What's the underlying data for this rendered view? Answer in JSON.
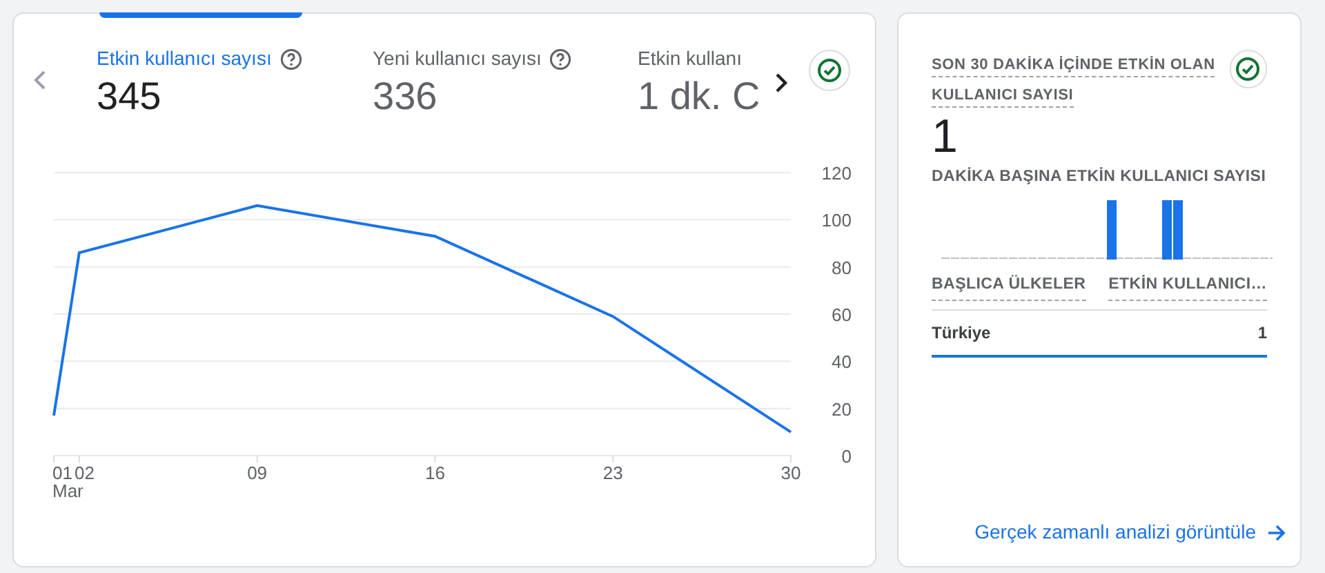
{
  "metrics": [
    {
      "label": "Etkin kullanıcı sayısı",
      "value": "345",
      "help": true,
      "selected": true
    },
    {
      "label": "Yeni kullanıcı sayısı",
      "value": "336",
      "help": true,
      "selected": false
    },
    {
      "label": "Etkin kullanı",
      "value": "1 dk. C",
      "help": false,
      "selected": false
    }
  ],
  "chart": {
    "chart_data": {
      "type": "line",
      "grid": true,
      "x": [
        1,
        2,
        9,
        16,
        23,
        30
      ],
      "xticks": [
        {
          "value": 1,
          "label": "01"
        },
        {
          "value": 2,
          "label": "02"
        },
        {
          "value": 9,
          "label": "09"
        },
        {
          "value": 16,
          "label": "16"
        },
        {
          "value": 23,
          "label": "23"
        },
        {
          "value": 30,
          "label": "30"
        }
      ],
      "xlim": [
        1,
        30
      ],
      "ylim": [
        0,
        120
      ],
      "yticks": [
        0,
        20,
        40,
        60,
        80,
        100,
        120
      ],
      "series": [
        {
          "color": "#1a73e8",
          "values": [
            17,
            86,
            106,
            93,
            59,
            10
          ]
        }
      ]
    },
    "month_label": "Mar"
  },
  "realtime": {
    "title": "SON 30 DAKİKA İÇİNDE ETKİN OLAN KULLANICI SAYISI",
    "value": "1",
    "per_minute_title": "DAKİKA BAŞINA ETKİN KULLANICI SAYISI",
    "table": {
      "columns": [
        "BAŞLICA ÜLKELER",
        "ETKİN KULLANICI…"
      ],
      "rows": [
        {
          "country": "Türkiye",
          "users": "1",
          "selected": true
        }
      ]
    },
    "link": "Gerçek zamanlı analizi görüntüle"
  }
}
